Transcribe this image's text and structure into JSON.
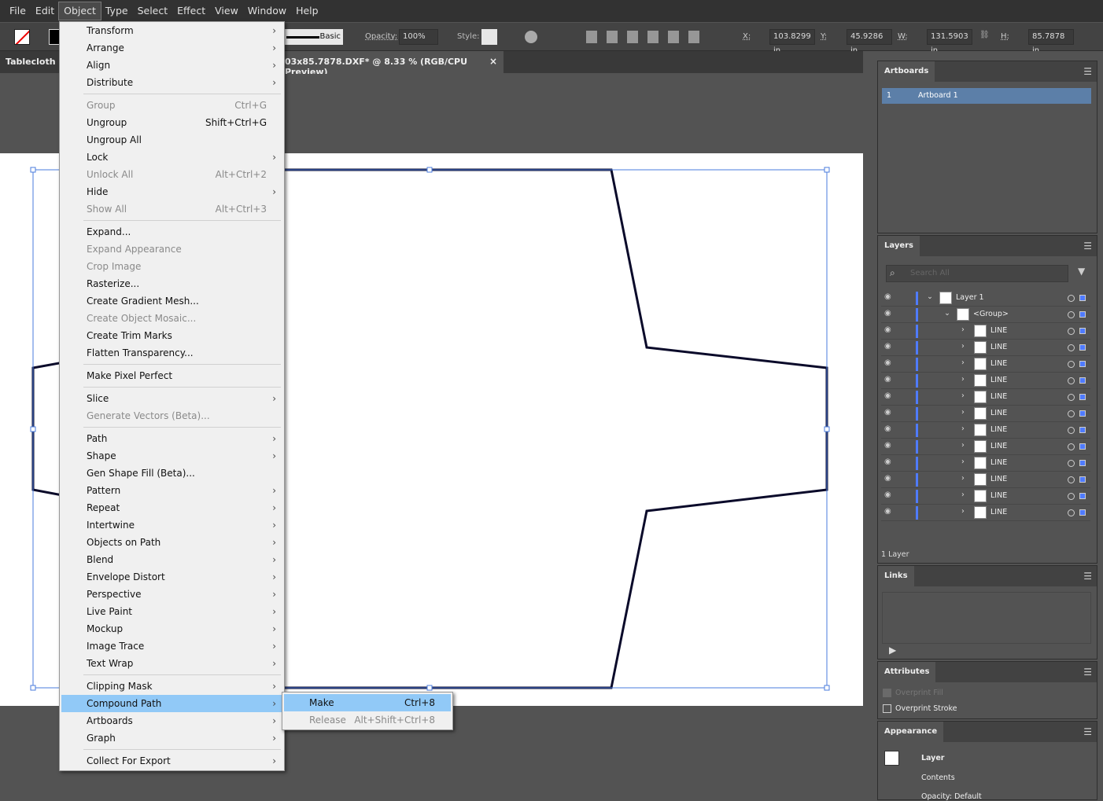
{
  "menubar": [
    "File",
    "Edit",
    "Object",
    "Type",
    "Select",
    "Effect",
    "View",
    "Window",
    "Help"
  ],
  "control": {
    "stroke_style": "Basic",
    "opacity_label": "Opacity:",
    "opacity": "100%",
    "style_label": "Style:",
    "x_label": "X:",
    "x": "103.8299 in",
    "y_label": "Y:",
    "y": "45.9286 in",
    "w_label": "W:",
    "w": "131.5903 in",
    "h_label": "H:",
    "h": "85.7878 in"
  },
  "tab": {
    "left": "Tablecloth St",
    "title": "03x85.7878.DXF* @ 8.33 % (RGB/CPU Preview)",
    "close": "×"
  },
  "menu": [
    {
      "l": "Transform",
      "a": 1
    },
    {
      "l": "Arrange",
      "a": 1
    },
    {
      "l": "Align",
      "a": 1
    },
    {
      "l": "Distribute",
      "a": 1
    },
    {
      "sep": 1
    },
    {
      "l": "Group",
      "s": "Ctrl+G",
      "d": 1
    },
    {
      "l": "Ungroup",
      "s": "Shift+Ctrl+G"
    },
    {
      "l": "Ungroup All"
    },
    {
      "l": "Lock",
      "a": 1
    },
    {
      "l": "Unlock All",
      "s": "Alt+Ctrl+2",
      "d": 1
    },
    {
      "l": "Hide",
      "a": 1
    },
    {
      "l": "Show All",
      "s": "Alt+Ctrl+3",
      "d": 1
    },
    {
      "sep": 1
    },
    {
      "l": "Expand..."
    },
    {
      "l": "Expand Appearance",
      "d": 1
    },
    {
      "l": "Crop Image",
      "d": 1
    },
    {
      "l": "Rasterize..."
    },
    {
      "l": "Create Gradient Mesh..."
    },
    {
      "l": "Create Object Mosaic...",
      "d": 1
    },
    {
      "l": "Create Trim Marks"
    },
    {
      "l": "Flatten Transparency..."
    },
    {
      "sep": 1
    },
    {
      "l": "Make Pixel Perfect"
    },
    {
      "sep": 1
    },
    {
      "l": "Slice",
      "a": 1
    },
    {
      "l": "Generate Vectors (Beta)...",
      "d": 1
    },
    {
      "sep": 1
    },
    {
      "l": "Path",
      "a": 1
    },
    {
      "l": "Shape",
      "a": 1
    },
    {
      "l": "Gen Shape Fill (Beta)..."
    },
    {
      "l": "Pattern",
      "a": 1
    },
    {
      "l": "Repeat",
      "a": 1
    },
    {
      "l": "Intertwine",
      "a": 1
    },
    {
      "l": "Objects on Path",
      "a": 1
    },
    {
      "l": "Blend",
      "a": 1
    },
    {
      "l": "Envelope Distort",
      "a": 1
    },
    {
      "l": "Perspective",
      "a": 1
    },
    {
      "l": "Live Paint",
      "a": 1
    },
    {
      "l": "Mockup",
      "a": 1
    },
    {
      "l": "Image Trace",
      "a": 1
    },
    {
      "l": "Text Wrap",
      "a": 1
    },
    {
      "sep": 1
    },
    {
      "l": "Clipping Mask",
      "a": 1
    },
    {
      "l": "Compound Path",
      "a": 1,
      "h": 1
    },
    {
      "l": "Artboards",
      "a": 1
    },
    {
      "l": "Graph",
      "a": 1
    },
    {
      "sep": 1
    },
    {
      "l": "Collect For Export",
      "a": 1
    }
  ],
  "submenu": [
    {
      "l": "Make",
      "s": "Ctrl+8",
      "h": 1
    },
    {
      "l": "Release",
      "s": "Alt+Shift+Ctrl+8",
      "d": 1
    }
  ],
  "artboards": {
    "title": "Artboards",
    "num": "1",
    "name": "Artboard 1"
  },
  "layers": {
    "title": "Layers",
    "search_placeholder": "Search All",
    "layer": "Layer 1",
    "group": "<Group>",
    "items": [
      "LINE",
      "LINE",
      "LINE",
      "LINE",
      "LINE",
      "LINE",
      "LINE",
      "LINE",
      "LINE",
      "LINE",
      "LINE",
      "LINE"
    ],
    "count": "1 Layer",
    "accent": "#4f7bff"
  },
  "links": {
    "title": "Links"
  },
  "attributes": {
    "title": "Attributes",
    "overprint_fill": "Overprint Fill",
    "overprint_stroke": "Overprint Stroke"
  },
  "appearance": {
    "title": "Appearance",
    "layer": "Layer",
    "contents": "Contents",
    "opacity": "Opacity:  Default"
  }
}
